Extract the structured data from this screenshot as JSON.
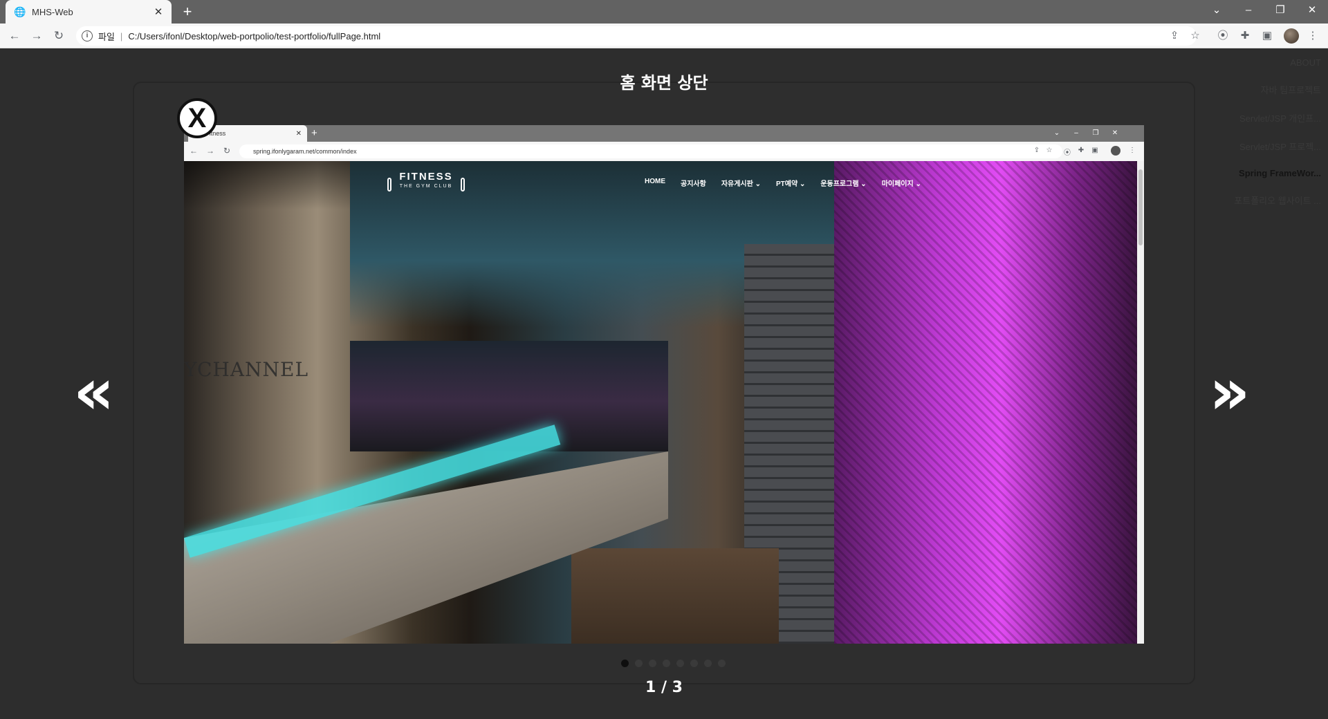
{
  "browser": {
    "tab_title": "MHS-Web",
    "tab_close": "✕",
    "new_tab": "+",
    "window_controls": {
      "dropdown": "⌄",
      "minimize": "–",
      "restore": "❐",
      "close": "✕"
    },
    "address_prefix": "파일",
    "address_url": "C:/Users/ifonl/Desktop/web-portpolio/test-portfolio/fullPage.html",
    "icons": [
      "back-icon",
      "forward-icon",
      "reload-icon",
      "info-icon",
      "share-icon",
      "star-icon",
      "extension-icon",
      "puzzle-icon",
      "sidepanel-icon",
      "profile-avatar",
      "menu-icon"
    ]
  },
  "right_nav": {
    "items": [
      {
        "label": "ABOUT",
        "active": false
      },
      {
        "label": "자바 팀프로젝트",
        "active": false
      },
      {
        "label": "Servlet/JSP 개인프...",
        "active": false
      },
      {
        "label": "Servlet/JSP 프로젝...",
        "active": false
      },
      {
        "label": "Spring FrameWor...",
        "active": true
      },
      {
        "label": "포트폴리오 웹사이트 ...",
        "active": false
      }
    ]
  },
  "modal": {
    "title": "홈 화면 상단",
    "close_label": "X",
    "prev_arrow": "«",
    "next_arrow": "»",
    "counter": "1 / 3",
    "dots_total": 8,
    "dots_active_index": 0
  },
  "screenshot": {
    "tab_title": "Fitness",
    "tab_close": "✕",
    "new_tab": "+",
    "url": "spring.ifonlygaram.net/common/index",
    "site_logo_title": "FITNESS",
    "site_logo_sub": "THE GYM CLUB",
    "background_sign": "YCHANNEL",
    "menu": [
      "HOME",
      "공지사항",
      "자유게시판 ⌄",
      "PT예약 ⌄",
      "운동프로그램 ⌄",
      "마이페이지 ⌄"
    ]
  },
  "colors": {
    "page_bg": "#2d2d2d",
    "accent_teal": "#46e3e6",
    "accent_purple": "#c03ad6",
    "text_white": "#ffffff"
  }
}
